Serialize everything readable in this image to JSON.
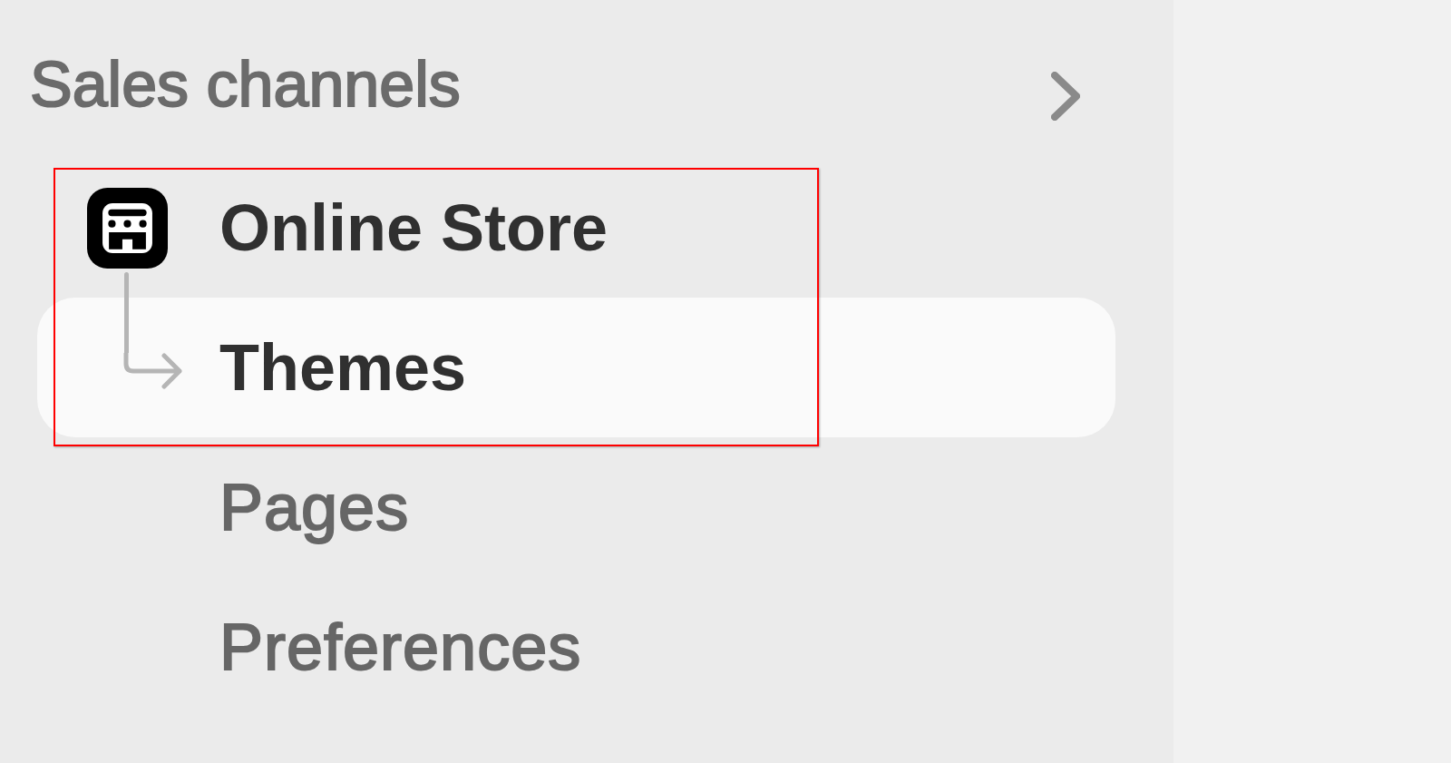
{
  "sidebar": {
    "heading": "Sales channels",
    "items": [
      {
        "label": "Online Store",
        "selected": false,
        "expanded": true,
        "framed": true,
        "children": [
          {
            "label": "Themes",
            "selected": true,
            "framed": true
          },
          {
            "label": "Pages",
            "selected": false,
            "framed": false
          },
          {
            "label": "Preferences",
            "selected": false,
            "framed": false
          }
        ]
      }
    ]
  }
}
